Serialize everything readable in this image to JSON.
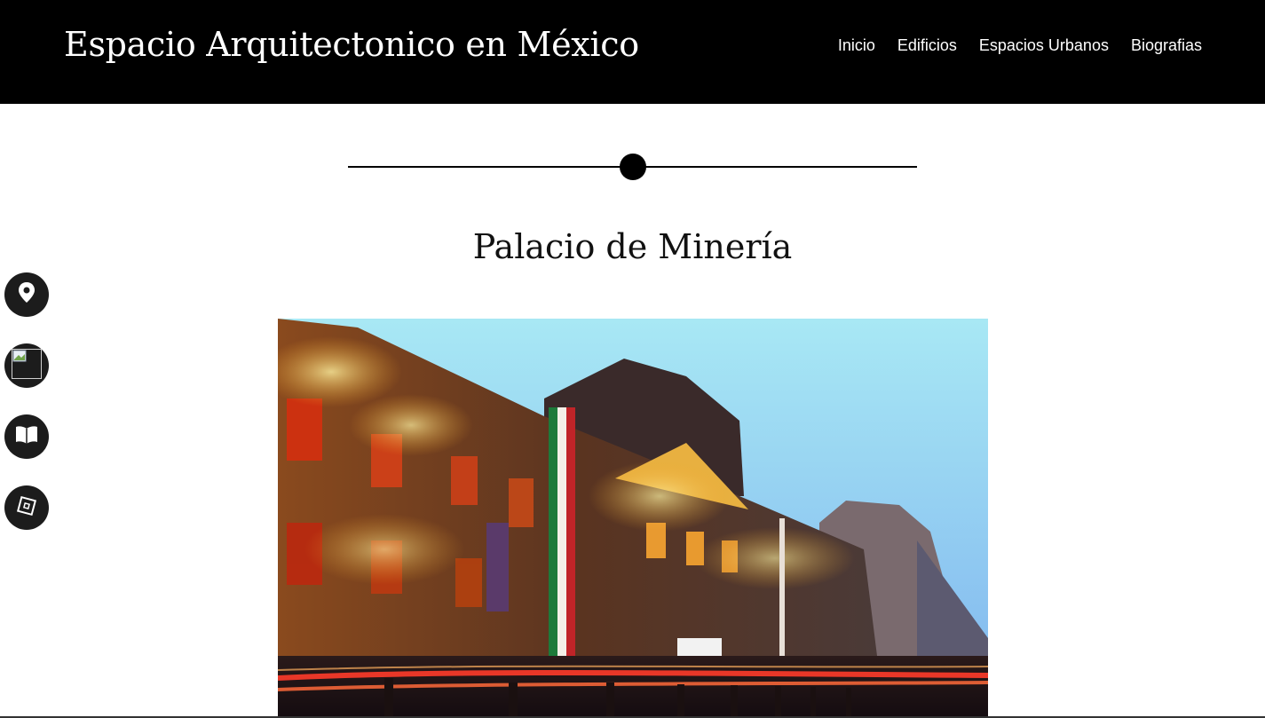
{
  "header": {
    "site_title": "Espacio Arquitectonico en México",
    "nav": [
      {
        "label": "Inicio"
      },
      {
        "label": "Edificios"
      },
      {
        "label": "Espacios Urbanos"
      },
      {
        "label": "Biografias"
      }
    ]
  },
  "main": {
    "title": "Palacio de Minería"
  },
  "side_nav": [
    {
      "icon": "map-pin-icon"
    },
    {
      "icon": "broken-image-icon"
    },
    {
      "icon": "book-icon"
    },
    {
      "icon": "cube-icon"
    }
  ],
  "colors": {
    "header_bg": "#000000",
    "text_light": "#ffffff",
    "side_button_bg": "#1c1c1c"
  }
}
